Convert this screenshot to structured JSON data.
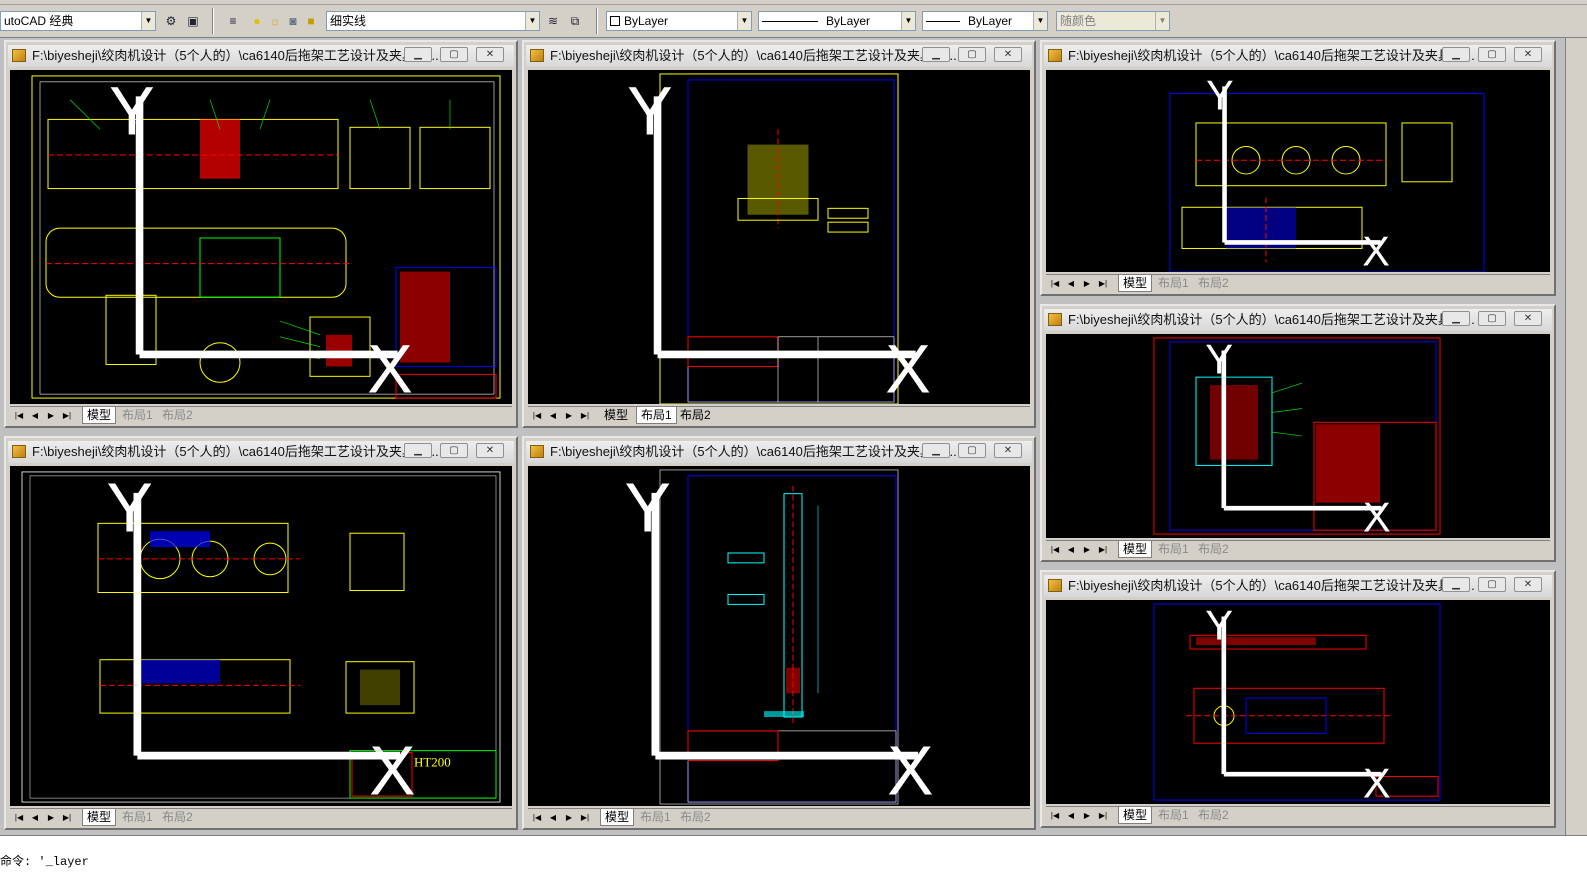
{
  "toolbar": {
    "workspace": "utoCAD 经典",
    "linetype_combo": "细实线",
    "color_combo": "ByLayer",
    "linetype2_combo": "ByLayer",
    "lineweight_combo": "ByLayer",
    "plotstyle_combo": "随颜色"
  },
  "windows": [
    {
      "title": "F:\\biyesheji\\绞肉机设计（5个人的）\\ca6140后拖架工艺设计及夹具设...",
      "tabs": [
        "模型",
        "布局1",
        "布局2"
      ],
      "active_tab": "模型"
    },
    {
      "title": "F:\\biyesheji\\绞肉机设计（5个人的）\\ca6140后拖架工艺设计及夹具设...",
      "tabs": [
        "模型",
        "布局1",
        "布局2"
      ],
      "active_tab": "布局1"
    },
    {
      "title": "F:\\biyesheji\\绞肉机设计（5个人的）\\ca6140后拖架工艺设计及夹具设...",
      "tabs": [
        "模型",
        "布局1",
        "布局2"
      ],
      "active_tab": "模型"
    },
    {
      "title": "F:\\biyesheji\\绞肉机设计（5个人的）\\ca6140后拖架工艺设计及夹具设...",
      "tabs": [
        "模型",
        "布局1",
        "布局2"
      ],
      "active_tab": "模型"
    },
    {
      "title": "F:\\biyesheji\\绞肉机设计（5个人的）\\ca6140后拖架工艺设计及夹具设...",
      "tabs": [
        "模型",
        "布局1",
        "布局2"
      ],
      "active_tab": "模型"
    },
    {
      "title": "F:\\biyesheji\\绞肉机设计（5个人的）\\ca6140后拖架工艺设计及夹具设...",
      "tabs": [
        "模型",
        "布局1",
        "布局2"
      ],
      "active_tab": "模型"
    },
    {
      "title": "F:\\biyesheji\\绞肉机设计（5个人的）\\ca6140后拖架工艺设计及夹具设...",
      "tabs": [
        "模型",
        "布局1",
        "布局2"
      ],
      "active_tab": "模型"
    }
  ],
  "drawing_text": {
    "ht200": "HT200",
    "ucs_x": "X",
    "ucs_y": "Y"
  },
  "command": {
    "line": "命令: '_layer"
  },
  "colors": {
    "canvas": "#000000",
    "yellow": "#ffff00",
    "green": "#00ff00",
    "cyan": "#00ffff",
    "red": "#ff0000",
    "blue": "#0000ff",
    "white": "#ffffff"
  }
}
